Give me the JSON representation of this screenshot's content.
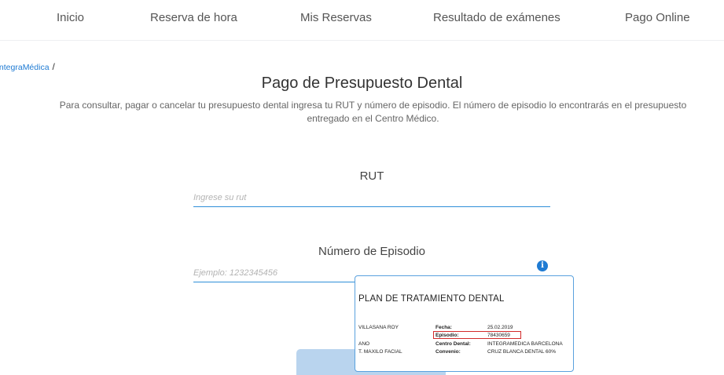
{
  "nav": {
    "items": [
      "Inicio",
      "Reserva de hora",
      "Mis Reservas",
      "Resultado de exámenes",
      "Pago Online"
    ]
  },
  "breadcrumb": {
    "home": "IntegraMédica",
    "separator": "/"
  },
  "page": {
    "title": "Pago de Presupuesto Dental",
    "description": "Para consultar, pagar o cancelar tu presupuesto dental ingresa tu RUT y número de episodio. El número de episodio lo encontrarás en el presupuesto entregado en el Centro Médico."
  },
  "form": {
    "rut_label": "RUT",
    "rut_value": "",
    "rut_placeholder": "Ingrese su rut",
    "episode_label": "Número de Episodio",
    "episode_value": "",
    "episode_placeholder": "Ejemplo: 1232345456",
    "info_icon": "info-icon",
    "submit_label": ""
  },
  "tooltip": {
    "title": "PLAN DE TRATAMIENTO DENTAL",
    "left_lines": [
      "VILLASANA ROY",
      "ANO",
      "T. MAXILO FACIAL"
    ],
    "rows": [
      {
        "key": "Fecha:",
        "value": "25.02.2019"
      },
      {
        "key": "Episodio:",
        "value": "78430659"
      },
      {
        "key": "Centro Dental:",
        "value": "INTEGRAMEDICA BARCELONA"
      },
      {
        "key": "Convenio:",
        "value": "CRUZ BLANCA DENTAL 60%"
      }
    ]
  },
  "colors": {
    "accent": "#1f7bd3",
    "input_underline": "#2f8fd8",
    "button_disabled": "#b9d4ee",
    "highlight": "#d22a2a"
  }
}
